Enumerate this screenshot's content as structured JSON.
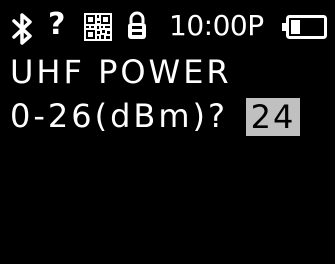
{
  "status_bar": {
    "icons": [
      "bluetooth-icon",
      "unknown-status-icon",
      "qr-code-icon",
      "lock-icon",
      "battery-icon"
    ],
    "unknown_glyph": "?",
    "time": "10:00P"
  },
  "screen": {
    "title": "UHF POWER",
    "prompt": "0-26(dBm)?",
    "value": "24"
  },
  "colors": {
    "background": "#000000",
    "foreground": "#ffffff",
    "field_background": "#c0c0c0",
    "field_text": "#000000"
  }
}
